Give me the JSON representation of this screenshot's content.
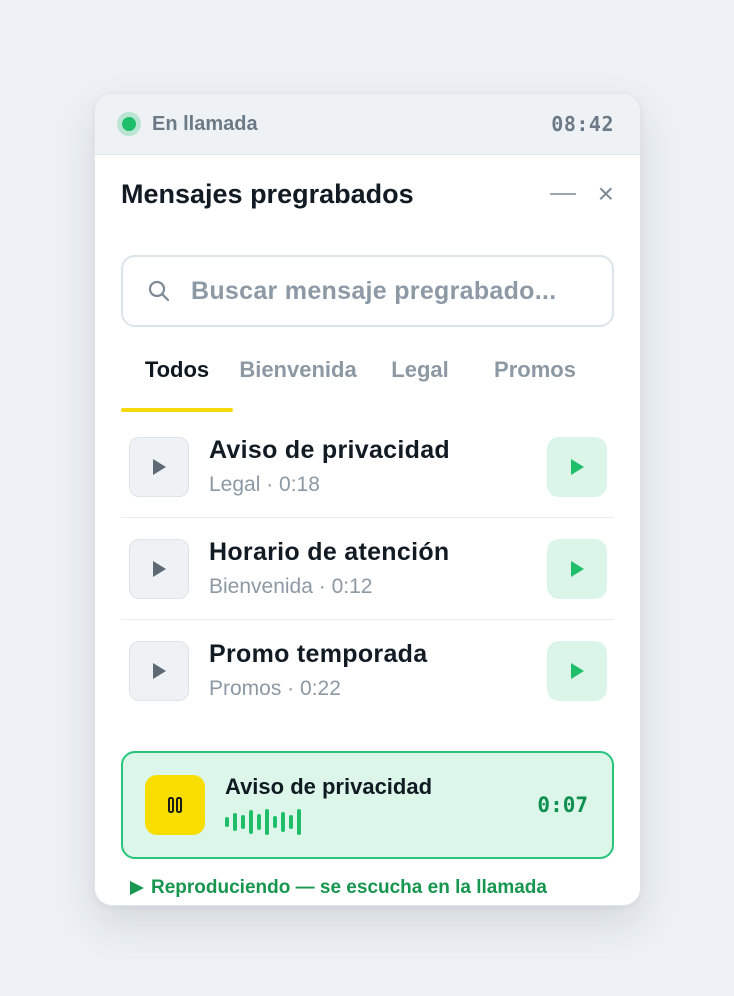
{
  "call": {
    "status": "En llamada",
    "timer": "08:42"
  },
  "header": {
    "title": "Mensajes pregrabados",
    "close": "×"
  },
  "search": {
    "placeholder": "Buscar mensaje pregrabado..."
  },
  "tabs": [
    {
      "label": "Todos",
      "active": true
    },
    {
      "label": "Bienvenida",
      "active": false
    },
    {
      "label": "Legal",
      "active": false
    },
    {
      "label": "Promos",
      "active": false
    }
  ],
  "messages": [
    {
      "title": "Aviso de privacidad",
      "meta": "Legal · 0:18"
    },
    {
      "title": "Horario de atención",
      "meta": "Bienvenida · 0:12"
    },
    {
      "title": "Promo temporada",
      "meta": "Promos · 0:22"
    }
  ],
  "now_playing": {
    "title": "Aviso de privacidad",
    "elapsed": "0:07"
  },
  "footer": {
    "status": "Reproduciendo — se escucha en la llamada"
  },
  "colors": {
    "accent_green": "#1fbe6b",
    "accent_yellow": "#f5d90a",
    "now_bg": "#ddf6ea"
  },
  "icons": {
    "search": "search-icon",
    "play": "play-icon",
    "pause": "pause-icon",
    "status": "play-triangle-icon"
  }
}
